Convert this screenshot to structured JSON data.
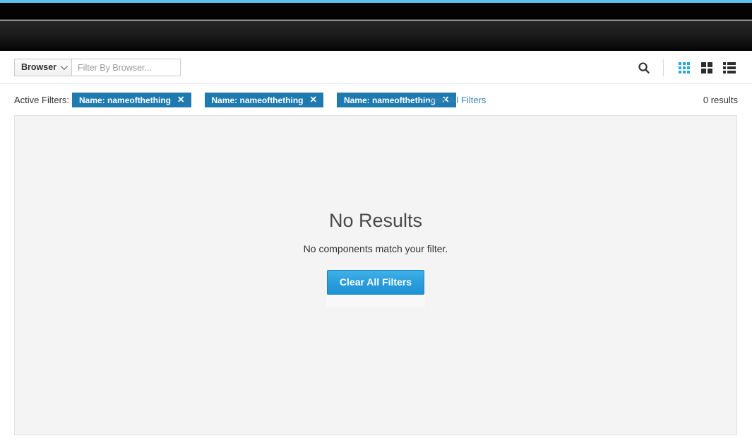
{
  "window": {
    "accent_color": "#5bc0f0",
    "masthead_color": "#030303",
    "navbar_color": "#1d1d1d"
  },
  "toolbar": {
    "filter_select": {
      "label": "Browser",
      "caret_icon": "chevron-down-icon"
    },
    "filter_input": {
      "value": "",
      "placeholder": "Filter By Browser..."
    },
    "search_icon": "search-icon",
    "view_modes": [
      {
        "name": "grid-small",
        "icon": "grid-3x3-icon",
        "active": true,
        "color": "#27a5e8"
      },
      {
        "name": "grid-large",
        "icon": "grid-2x2-icon",
        "active": false,
        "color": "#2d2d2d"
      },
      {
        "name": "list",
        "icon": "list-icon",
        "active": false,
        "color": "#2d2d2d"
      }
    ]
  },
  "filters": {
    "label": "Active Filters:",
    "pills": [
      {
        "text": "Name: nameofthething",
        "remove_icon": "close-icon"
      },
      {
        "text": "Name: nameofthething",
        "remove_icon": "close-icon"
      },
      {
        "text": "Name: nameofthething",
        "remove_icon": "close-icon"
      }
    ],
    "clear_all_label": "Clear All Filters",
    "pill_color": "#1f7ab0",
    "link_color": "#3a83b8"
  },
  "results": {
    "count_label": "0 results"
  },
  "empty_state": {
    "title": "No Results",
    "subtitle": "No components match your filter.",
    "button_label": "Clear All Filters",
    "button_color": "#2a9ddb"
  }
}
